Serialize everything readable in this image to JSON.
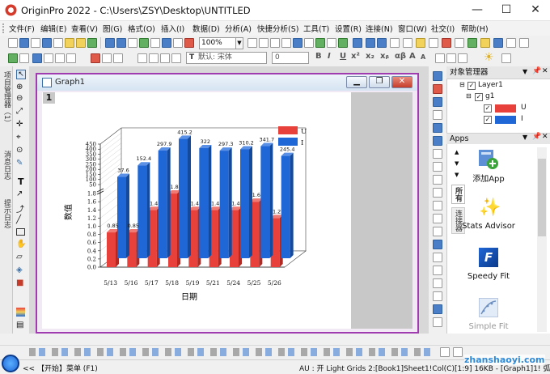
{
  "window": {
    "title": "OriginPro 2022 - C:\\Users\\ZSY\\Desktop\\UNTITLED",
    "minimize": "—",
    "maximize": "☐",
    "close": "✕"
  },
  "menu": [
    "文件(F)",
    "编辑(E)",
    "查看(V)",
    "图(G)",
    "格式(O)",
    "插入(I)",
    "数据(D)",
    "分析(A)",
    "快捷分析(S)",
    "工具(T)",
    "设置(R)",
    "连接(N)",
    "窗口(W)",
    "社交(I)",
    "帮助(H)"
  ],
  "toolbar": {
    "zoom": "100%",
    "font_name": "默认: 宋体",
    "font_size": "0",
    "format_buttons": [
      "B",
      "I",
      "U",
      "x²",
      "x₂",
      "xᵦ",
      "αβ",
      "A",
      "A"
    ]
  },
  "left_tabs": [
    "项目管理器（1）",
    "消息日志",
    "提示日志"
  ],
  "graph_window": {
    "title": "Graph1",
    "layer": "1"
  },
  "object_manager": {
    "title": "对象管理器",
    "items": [
      {
        "label": "Layer1"
      },
      {
        "label": "g1"
      },
      {
        "label": "U",
        "color": "#e8413c"
      },
      {
        "label": "I",
        "color": "#1f66d6"
      }
    ]
  },
  "apps": {
    "title": "Apps",
    "tabs": [
      "所有",
      "连接器"
    ],
    "items": [
      "添加App",
      "Stats Advisor",
      "Speedy Fit",
      "Simple Fit"
    ]
  },
  "status": {
    "start_label": "<< 【开始】菜单 (F1)",
    "info": "AU : 开  Light Grids  2:[Book1]Sheet1!Col(C)[1:9]  16KB - [Graph1]1!  弧度",
    "watermark": "zhanshaoyi.com"
  },
  "chart_data": {
    "type": "bar",
    "categories": [
      "5/13",
      "5/16",
      "5/17",
      "5/18",
      "5/19",
      "5/21",
      "5/24",
      "5/25",
      "5/26"
    ],
    "series": [
      {
        "name": "U",
        "color": "#e8413c",
        "values": [
          0.85,
          0.85,
          1.4,
          1.8,
          1.4,
          1.4,
          1.4,
          1.6,
          1.2
        ]
      },
      {
        "name": "I",
        "color": "#1f66d6",
        "values": [
          37.6,
          152.4,
          297.9,
          415.2,
          322,
          297.3,
          310.2,
          341.7,
          245.4
        ]
      }
    ],
    "data_labels": {
      "U": [
        "0.85",
        "0.85",
        "1.4",
        "1.8",
        "1.4",
        "1.4",
        "1.4",
        "1.6",
        "1.2"
      ],
      "I": [
        "37.6",
        "152.4",
        "297.9",
        "415.2",
        "322",
        "297.3",
        "310.2",
        "341.7",
        "245.4"
      ]
    },
    "xlabel": "日期",
    "ylabel": "数值",
    "yticks_lower": [
      "0.0",
      "0.2",
      "0.4",
      "0.6",
      "0.8",
      "1.0",
      "1.2",
      "1.4",
      "1.6",
      "1.8"
    ],
    "yticks_upper": [
      "50",
      "100",
      "150",
      "200",
      "250",
      "300",
      "350",
      "400",
      "450"
    ],
    "y_break": {
      "lower": [
        0,
        1.9
      ],
      "upper": [
        1.9,
        450
      ]
    },
    "legend_position": "top-right",
    "grid": true
  }
}
